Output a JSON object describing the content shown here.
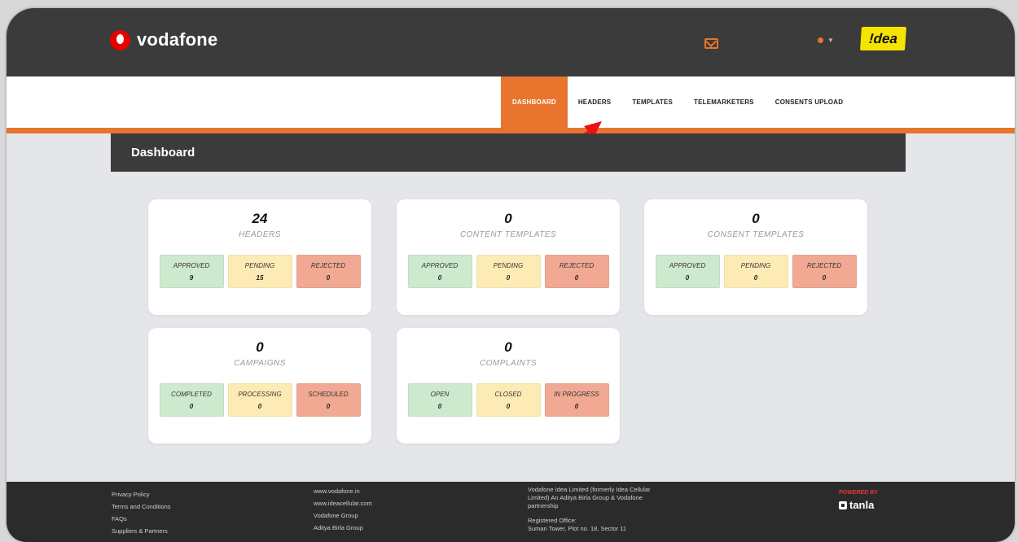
{
  "header": {
    "brand": "vodafone",
    "partner_logo": "!dea",
    "icons": [
      "mail-icon",
      "user-icon",
      "chevron-down-icon"
    ]
  },
  "nav": {
    "items": [
      {
        "label": "DASHBOARD",
        "active": true
      },
      {
        "label": "HEADERS",
        "active": false
      },
      {
        "label": "TEMPLATES",
        "active": false
      },
      {
        "label": "TELEMARKETERS",
        "active": false
      },
      {
        "label": "CONSENTS UPLOAD",
        "active": false
      }
    ]
  },
  "page": {
    "title": "Dashboard"
  },
  "cards": [
    {
      "count": "24",
      "label": "HEADERS",
      "stats": [
        {
          "label": "APPROVED",
          "value": "9"
        },
        {
          "label": "PENDING",
          "value": "15"
        },
        {
          "label": "REJECTED",
          "value": "0"
        }
      ]
    },
    {
      "count": "0",
      "label": "CONTENT TEMPLATES",
      "stats": [
        {
          "label": "APPROVED",
          "value": "0"
        },
        {
          "label": "PENDING",
          "value": "0"
        },
        {
          "label": "REJECTED",
          "value": "0"
        }
      ]
    },
    {
      "count": "0",
      "label": "CONSENT TEMPLATES",
      "stats": [
        {
          "label": "APPROVED",
          "value": "0"
        },
        {
          "label": "PENDING",
          "value": "0"
        },
        {
          "label": "REJECTED",
          "value": "0"
        }
      ]
    },
    {
      "count": "0",
      "label": "CAMPAIGNS",
      "stats": [
        {
          "label": "COMPLETED",
          "value": "0"
        },
        {
          "label": "PROCESSING",
          "value": "0"
        },
        {
          "label": "SCHEDULED",
          "value": "0"
        }
      ]
    },
    {
      "count": "0",
      "label": "COMPLAINTS",
      "stats": [
        {
          "label": "OPEN",
          "value": "0"
        },
        {
          "label": "CLOSED",
          "value": "0"
        },
        {
          "label": "IN PROGRESS",
          "value": "0"
        }
      ]
    }
  ],
  "footer": {
    "col1": [
      "Privacy Policy",
      "Terms and Conditions",
      "FAQs",
      "Suppliers & Partners"
    ],
    "col2": [
      "www.vodafone.in",
      "www.ideacellular.com",
      "Vodafone Group",
      "Aditya Birla Group"
    ],
    "col3": [
      "Vodafone Idea Limited (formerly Idea Cellular",
      "Limited) An Aditya Birla Group & Vodafone",
      "partnership",
      "",
      "Registered Office:",
      "Suman Tower, Plot no. 18, Sector 11"
    ],
    "powered_by": "POWERED BY",
    "powered_brand": "tanla"
  },
  "colors": {
    "accent": "#e8742e",
    "header_bg": "#3b3b3b",
    "approved": "#cde9ce",
    "pending": "#fdebb5",
    "rejected": "#f1a993"
  }
}
